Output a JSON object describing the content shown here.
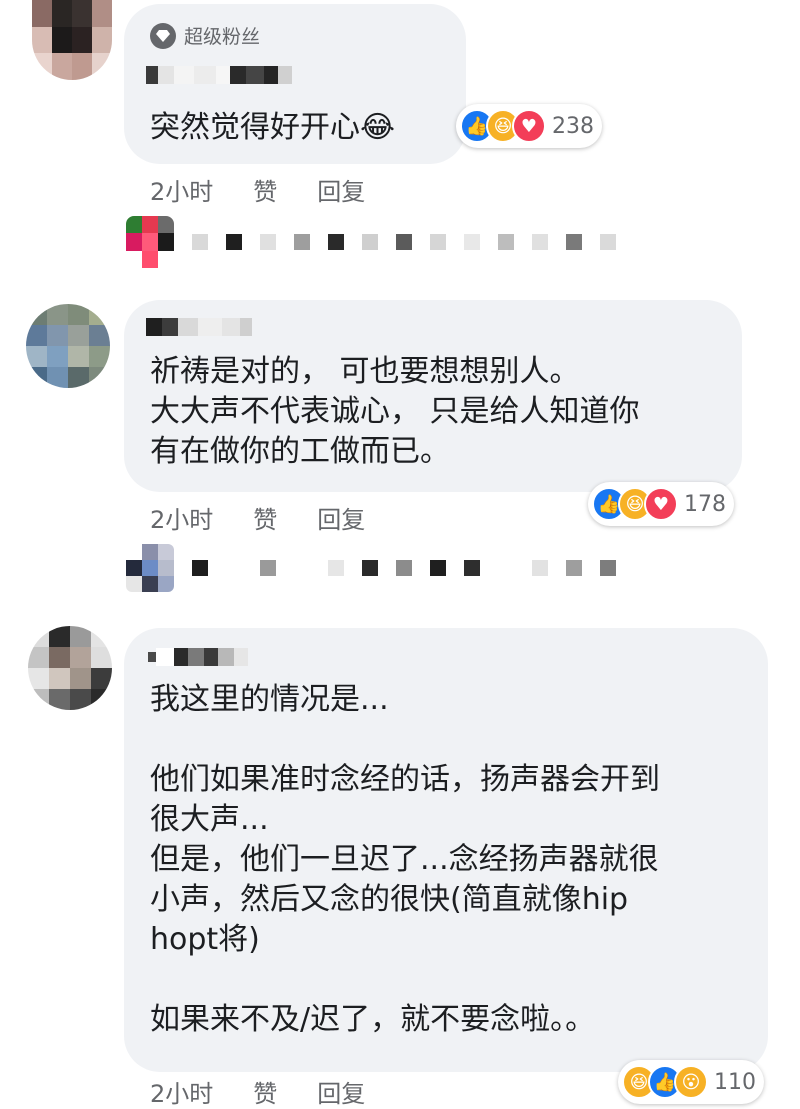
{
  "comment1": {
    "badge": "超级粉丝",
    "text": "突然觉得好开心😂",
    "reaction_count": "238",
    "time": "2小时",
    "like_label": "赞",
    "reply_label": "回复"
  },
  "comment2": {
    "text": "祈祷是对的， 可也要想想别人。\n大大声不代表诚心， 只是给人知道你\n有在做你的工做而已。",
    "reaction_count": "178",
    "time": "2小时",
    "like_label": "赞",
    "reply_label": "回复"
  },
  "comment3": {
    "text": "我这里的情况是...\n\n他们如果准时念经的话，扬声器会开到\n很大声...\n但是，他们一旦迟了...念经扬声器就很\n小声，然后又念的很快(简直就像hip\nhopt将)\n\n如果来不及/迟了，就不要念啦。。",
    "reaction_count": "110",
    "time": "2小时",
    "like_label": "赞",
    "reply_label": "回复"
  },
  "icons": {
    "badge": "diamond-icon",
    "like": "thumbs-up-icon",
    "haha": "laughing-face-icon",
    "love": "heart-icon",
    "wow": "surprised-face-icon"
  },
  "colors": {
    "bubble": "#f0f2f5",
    "like": "#1877f2",
    "love": "#f33e58",
    "haha": "#f7b125",
    "meta_text": "#65676b"
  }
}
